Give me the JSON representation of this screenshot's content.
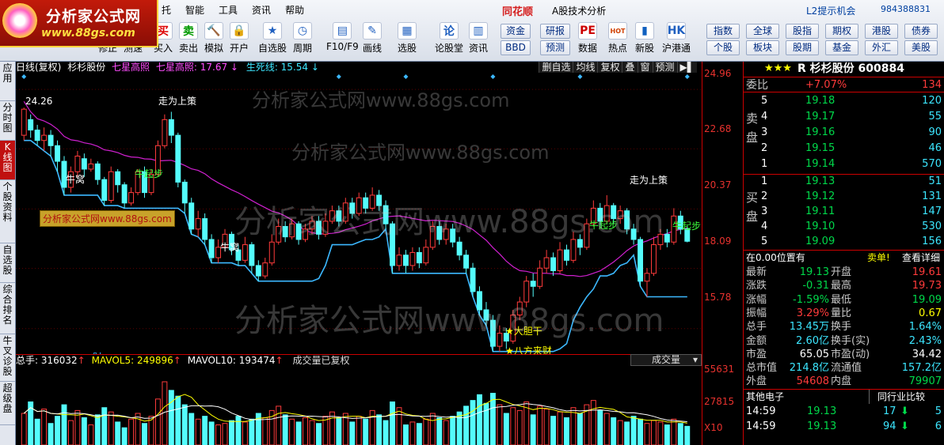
{
  "logo": {
    "name": "分析家公式网",
    "url": "www.88gs.com"
  },
  "menu": [
    "托",
    "智能",
    "工具",
    "资讯",
    "帮助"
  ],
  "brand": "同花顺",
  "app_title": "A股技术分析",
  "l2_tip": "L2提示机会",
  "account": "984388831",
  "toolbar": [
    {
      "icon": "sell-icon",
      "label": "修正",
      "glyph": "卖"
    },
    {
      "icon": "auction-icon",
      "label": "测速",
      "glyph": "⚒"
    },
    {
      "icon": "buy-icon",
      "label": "买入",
      "glyph": "买"
    },
    {
      "icon": "sell-green-icon",
      "label": "卖出",
      "glyph": "卖"
    },
    {
      "icon": "hammer-icon",
      "label": "模拟",
      "glyph": "🔨"
    },
    {
      "icon": "lock-icon",
      "label": "开户",
      "glyph": "🔒"
    },
    {
      "icon": "star-icon",
      "label": "自选股",
      "glyph": "★"
    },
    {
      "icon": "clock-icon",
      "label": "周期",
      "glyph": "◷"
    },
    {
      "icon": "f10-icon",
      "label": "F10/F9",
      "glyph": "▤"
    },
    {
      "icon": "pen-icon",
      "label": "画线",
      "glyph": "✎"
    },
    {
      "icon": "select-stock-icon",
      "label": "选股",
      "glyph": "▦"
    },
    {
      "icon": "formula-icon",
      "label": "论股堂",
      "glyph": "论"
    },
    {
      "icon": "news-icon",
      "label": "资讯",
      "glyph": "▥"
    },
    {
      "icon": "pe-icon",
      "label": "数据",
      "glyph": "PE"
    },
    {
      "icon": "hot-icon",
      "label": "热点",
      "glyph": "HOT"
    },
    {
      "icon": "newstock-icon",
      "label": "新股",
      "glyph": "▮"
    },
    {
      "icon": "hk-icon",
      "label": "沪港通",
      "glyph": "HK"
    }
  ],
  "tool_buttons_mid": [
    [
      "资金",
      "研报"
    ],
    [
      "BBD",
      "预测"
    ]
  ],
  "tool_buttons_right": [
    [
      "指数",
      "全球",
      "股指",
      "期权",
      "港股",
      "债券"
    ],
    [
      "个股",
      "板块",
      "股期",
      "基金",
      "外汇",
      "美股"
    ]
  ],
  "left_nav": [
    "应用",
    "分时图",
    "K线图",
    "个股资料",
    "自选股",
    "综合排名",
    "牛叉诊股",
    "超级盘"
  ],
  "info_bar": {
    "prefix": "日线(复权)",
    "stock": "杉杉股份",
    "ind1": "七星高照",
    "ind2": "七星高照: 17.67",
    "ind3": "生死线: 15.54"
  },
  "chart_buttons": [
    "删自选",
    "均线",
    "复权",
    "叠",
    "窗",
    "预测"
  ],
  "price_axis": [
    "24.96",
    "22.68",
    "20.37",
    "18.09",
    "15.78"
  ],
  "volume_axis": [
    "55631",
    "27815",
    "X10"
  ],
  "annotations": {
    "high_label": "24.26",
    "up1": "走为上策",
    "up2": "走为上策",
    "cow1": "牛窝",
    "cow2": "牛窝",
    "start1": "牛起步",
    "start2": "牛起步",
    "start3": "牛起步",
    "bold": "★大胆干",
    "fortune": "★八方来财",
    "cai": "财"
  },
  "watermarks": [
    "分析家公式网www.88gs.com",
    "分析家公式网www.88gs.com",
    "分析家公式网www.88gs.com",
    "分析家公式网www.88gs.com"
  ],
  "wm_box": "分析家公式网www.88gs.com",
  "volume_bar": {
    "total": "总手: 316032",
    "mavol5": "MAVOL5: 249896",
    "mavol10": "MAVOL10: 193474",
    "note": "成交量已复权",
    "dropdown": "成交量"
  },
  "stock_header": {
    "stars": "★★★",
    "code_name": "R 杉杉股份 600884"
  },
  "weibi": {
    "label": "委比",
    "pct": "+7.07%",
    "diff": "134"
  },
  "sell_label": "卖盘",
  "buy_label": "买盘",
  "asks": [
    {
      "n": "5",
      "price": "19.18",
      "vol": "120"
    },
    {
      "n": "4",
      "price": "19.17",
      "vol": "55"
    },
    {
      "n": "3",
      "price": "19.16",
      "vol": "90"
    },
    {
      "n": "2",
      "price": "19.15",
      "vol": "46"
    },
    {
      "n": "1",
      "price": "19.14",
      "vol": "570"
    }
  ],
  "bids": [
    {
      "n": "1",
      "price": "19.13",
      "vol": "51"
    },
    {
      "n": "2",
      "price": "19.12",
      "vol": "131"
    },
    {
      "n": "3",
      "price": "19.11",
      "vol": "147"
    },
    {
      "n": "4",
      "price": "19.10",
      "vol": "530"
    },
    {
      "n": "5",
      "price": "19.09",
      "vol": "156"
    }
  ],
  "position_line": {
    "left": "在0.00位置有",
    "right1": "卖单!",
    "right2": "查看详细"
  },
  "quote": [
    {
      "l": "最新",
      "v": "19.13",
      "l2": "开盘",
      "v2": "19.61"
    },
    {
      "l": "涨跌",
      "v": "-0.31",
      "l2": "最高",
      "v2": "19.73"
    },
    {
      "l": "涨幅",
      "v": "-1.59%",
      "l2": "最低",
      "v2": "19.09"
    },
    {
      "l": "振幅",
      "v": "3.29%",
      "l2": "量比",
      "v2": "0.67"
    },
    {
      "l": "总手",
      "v": "13.45万",
      "l2": "换手",
      "v2": "1.64%"
    },
    {
      "l": "金额",
      "v": "2.60亿",
      "l2": "换手(实)",
      "v2": "2.43%"
    },
    {
      "l": "市盈",
      "v": "65.05",
      "l2": "市盈(动)",
      "v2": "34.42"
    },
    {
      "l": "总市值",
      "v": "214.8亿",
      "l2": "流通值",
      "v2": "157.2亿"
    },
    {
      "l": "外盘",
      "v": "54608",
      "l2": "内盘",
      "v2": "79907"
    }
  ],
  "sector": {
    "left": "其他电子",
    "right": "同行业比较"
  },
  "ticks": [
    {
      "time": "14:59",
      "price": "19.13",
      "vol": "17",
      "n": "5"
    },
    {
      "time": "14:59",
      "price": "19.13",
      "vol": "94",
      "n": "6"
    }
  ],
  "chart_data": {
    "type": "candlestick",
    "ylim": [
      14.8,
      25.6
    ],
    "candles": [
      [
        23.2,
        24.2,
        24.26,
        23.0
      ],
      [
        23.8,
        23.4,
        24.0,
        23.1
      ],
      [
        23.4,
        23.0,
        23.6,
        22.8
      ],
      [
        23.0,
        23.2,
        23.5,
        22.6
      ],
      [
        23.2,
        22.8,
        23.4,
        22.4
      ],
      [
        22.8,
        22.2,
        23.0,
        21.8
      ],
      [
        22.2,
        21.2,
        22.4,
        20.9
      ],
      [
        21.2,
        21.8,
        22.0,
        21.0
      ],
      [
        21.8,
        22.4,
        22.6,
        21.6
      ],
      [
        22.3,
        21.9,
        22.5,
        21.6
      ],
      [
        21.9,
        22.1,
        22.3,
        21.8
      ],
      [
        22.1,
        21.5,
        22.2,
        21.3
      ],
      [
        21.5,
        20.7,
        21.6,
        20.5
      ],
      [
        20.7,
        21.8,
        22.0,
        20.6
      ],
      [
        21.8,
        21.3,
        21.9,
        21.0
      ],
      [
        21.3,
        20.6,
        21.4,
        20.4
      ],
      [
        20.6,
        21.0,
        21.2,
        20.5
      ],
      [
        21.0,
        21.8,
        21.9,
        20.9
      ],
      [
        21.8,
        21.0,
        22.0,
        20.8
      ],
      [
        21.0,
        21.7,
        21.9,
        20.9
      ],
      [
        21.7,
        22.8,
        23.0,
        21.6
      ],
      [
        22.8,
        23.8,
        24.0,
        22.7
      ],
      [
        23.8,
        23.2,
        24.1,
        22.9
      ],
      [
        23.2,
        21.4,
        23.3,
        21.2
      ],
      [
        21.4,
        20.6,
        21.5,
        20.2
      ],
      [
        20.6,
        19.6,
        20.8,
        19.4
      ],
      [
        19.6,
        20.0,
        20.3,
        19.3
      ],
      [
        20.0,
        19.2,
        20.2,
        19.0
      ],
      [
        19.2,
        18.5,
        19.4,
        18.3
      ],
      [
        18.5,
        18.9,
        19.2,
        18.3
      ],
      [
        18.9,
        19.4,
        19.6,
        18.8
      ],
      [
        19.4,
        18.8,
        19.5,
        18.6
      ],
      [
        18.8,
        18.4,
        19.0,
        18.2
      ],
      [
        18.4,
        19.0,
        19.3,
        18.3
      ],
      [
        19.0,
        18.2,
        19.1,
        17.9
      ],
      [
        18.2,
        17.8,
        18.4,
        17.6
      ],
      [
        17.8,
        18.3,
        18.5,
        17.7
      ],
      [
        18.3,
        19.1,
        19.4,
        18.2
      ],
      [
        19.1,
        19.7,
        20.0,
        19.0
      ],
      [
        19.7,
        19.3,
        19.9,
        19.1
      ],
      [
        19.3,
        19.8,
        20.0,
        19.2
      ],
      [
        19.8,
        19.2,
        19.9,
        19.0
      ],
      [
        19.2,
        19.6,
        19.8,
        19.1
      ],
      [
        19.6,
        19.9,
        20.1,
        19.4
      ],
      [
        19.9,
        19.4,
        20.1,
        19.2
      ],
      [
        19.4,
        19.9,
        20.2,
        19.3
      ],
      [
        19.9,
        20.3,
        20.5,
        19.8
      ],
      [
        20.3,
        19.9,
        20.5,
        19.7
      ],
      [
        19.9,
        20.6,
        20.8,
        19.8
      ],
      [
        20.6,
        20.2,
        20.8,
        20.0
      ],
      [
        20.2,
        20.8,
        21.0,
        20.1
      ],
      [
        20.8,
        20.4,
        21.0,
        20.2
      ],
      [
        20.4,
        20.9,
        21.2,
        20.3
      ],
      [
        20.9,
        20.5,
        21.1,
        20.3
      ],
      [
        20.5,
        19.8,
        20.7,
        19.6
      ],
      [
        19.8,
        18.2,
        19.9,
        17.9
      ],
      [
        18.2,
        18.6,
        18.9,
        18.0
      ],
      [
        18.6,
        18.2,
        18.8,
        17.9
      ],
      [
        18.2,
        18.7,
        18.9,
        18.0
      ],
      [
        18.7,
        18.3,
        18.9,
        18.1
      ],
      [
        18.3,
        18.9,
        19.2,
        18.2
      ],
      [
        18.9,
        19.7,
        19.9,
        18.8
      ],
      [
        19.7,
        19.2,
        19.9,
        19.0
      ],
      [
        19.2,
        19.6,
        19.8,
        19.0
      ],
      [
        19.6,
        19.1,
        19.8,
        18.9
      ],
      [
        19.1,
        18.6,
        19.3,
        18.4
      ],
      [
        18.6,
        18.1,
        18.8,
        17.9
      ],
      [
        18.1,
        17.2,
        18.3,
        17.0
      ],
      [
        17.2,
        16.5,
        17.4,
        16.3
      ],
      [
        16.5,
        16.1,
        16.8,
        15.9
      ],
      [
        16.1,
        15.1,
        16.3,
        14.9
      ],
      [
        15.1,
        15.6,
        15.9,
        14.9
      ],
      [
        15.6,
        15.3,
        15.8,
        15.0
      ],
      [
        15.3,
        16.3,
        16.5,
        15.2
      ],
      [
        16.3,
        16.8,
        17.0,
        16.1
      ],
      [
        16.8,
        17.6,
        17.8,
        16.6
      ],
      [
        17.6,
        17.4,
        17.9,
        17.0
      ],
      [
        17.4,
        18.1,
        18.4,
        17.3
      ],
      [
        18.1,
        18.5,
        18.8,
        17.9
      ],
      [
        18.5,
        18.0,
        18.7,
        17.8
      ],
      [
        18.0,
        18.8,
        19.1,
        17.9
      ],
      [
        18.8,
        18.4,
        19.0,
        18.2
      ],
      [
        18.4,
        19.2,
        19.5,
        18.3
      ],
      [
        19.2,
        18.9,
        19.4,
        18.6
      ],
      [
        18.9,
        19.8,
        20.0,
        18.8
      ],
      [
        19.8,
        20.4,
        20.7,
        19.7
      ],
      [
        20.4,
        19.9,
        20.6,
        19.7
      ],
      [
        19.9,
        20.5,
        20.9,
        19.8
      ],
      [
        20.5,
        20.0,
        20.6,
        19.8
      ],
      [
        20.0,
        20.3,
        20.5,
        19.8
      ],
      [
        20.3,
        19.6,
        20.4,
        19.4
      ],
      [
        19.6,
        19.2,
        19.8,
        19.0
      ],
      [
        19.2,
        17.6,
        19.3,
        17.4
      ],
      [
        17.6,
        17.9,
        18.1,
        17.0
      ],
      [
        17.9,
        19.0,
        19.3,
        17.8
      ],
      [
        19.0,
        19.4,
        19.6,
        18.8
      ],
      [
        19.4,
        19.1,
        19.6,
        18.9
      ],
      [
        19.1,
        20.1,
        20.4,
        19.0
      ],
      [
        20.1,
        19.6,
        20.3,
        19.4
      ],
      [
        19.6,
        19.13,
        19.73,
        19.09
      ]
    ],
    "volumes": [
      22,
      30,
      18,
      25,
      15,
      20,
      28,
      17,
      24,
      19,
      14,
      21,
      26,
      23,
      16,
      12,
      18,
      22,
      15,
      20,
      32,
      44,
      38,
      34,
      28,
      22,
      18,
      20,
      16,
      14,
      15,
      17,
      20,
      16,
      18,
      22,
      19,
      24,
      27,
      21,
      18,
      16,
      19,
      17,
      15,
      20,
      23,
      19,
      22,
      16,
      20,
      18,
      24,
      21,
      17,
      30,
      26,
      14,
      16,
      15,
      18,
      22,
      19,
      17,
      20,
      23,
      27,
      31,
      35,
      29,
      36,
      28,
      22,
      26,
      24,
      30,
      21,
      27,
      25,
      20,
      23,
      19,
      26,
      22,
      28,
      31,
      24,
      22,
      19,
      17,
      16,
      20,
      18,
      15,
      17,
      16,
      14,
      18,
      15,
      13
    ]
  }
}
